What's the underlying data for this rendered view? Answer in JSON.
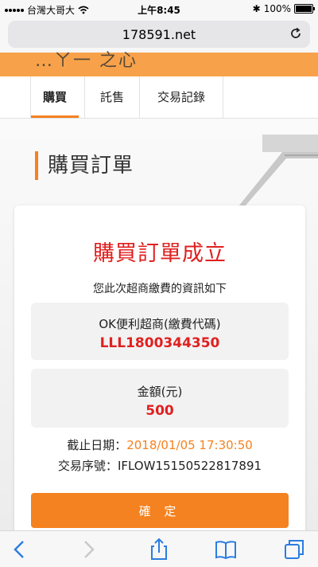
{
  "status_bar": {
    "carrier": "台灣大哥大",
    "time": "上午8:45",
    "battery": "100%"
  },
  "browser": {
    "url": "178591.net"
  },
  "header": {
    "brand": "…ㄚ一 之心"
  },
  "tabs": [
    {
      "label": "購買",
      "active": true
    },
    {
      "label": "託售",
      "active": false
    },
    {
      "label": "交易記錄",
      "active": false
    }
  ],
  "page": {
    "title": "購買訂單"
  },
  "result": {
    "title": "購買訂單成立",
    "subtitle": "您此次超商繳費的資訊如下",
    "payment_label": "OK便利超商(繳費代碼)",
    "payment_code": "LLL1800344350",
    "amount_label": "金額(元)",
    "amount": "500",
    "deadline_label": "截止日期：",
    "deadline": "2018/01/05 17:30:50",
    "txn_label": "交易序號：",
    "txn_id": "IFLOW15150522817891",
    "confirm_label": "確 定"
  },
  "colors": {
    "accent": "#f58220",
    "alert": "#e02020"
  }
}
